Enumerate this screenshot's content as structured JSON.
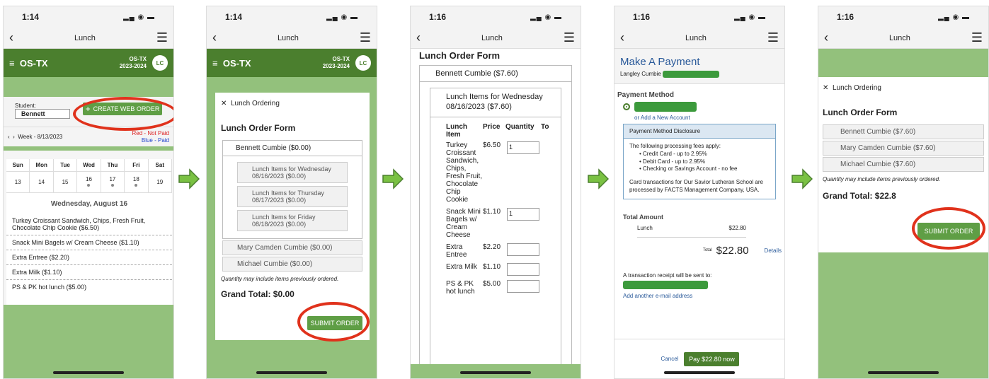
{
  "status_time": [
    "1:14",
    "1:14",
    "1:16",
    "1:16",
    "1:16"
  ],
  "nav_title": "Lunch",
  "appbar": {
    "org": "OS-TX",
    "org_short": "OS-TX",
    "year": "2023-2024",
    "avatar": "LC"
  },
  "screen1": {
    "student_label": "Student:",
    "student_value": "Bennett",
    "create_button": "CREATE WEB ORDER",
    "week_label": "Week - 8/13/2023",
    "legend_red": "Red - Not Paid",
    "legend_blue": "Blue - Paid",
    "days": [
      "Sun",
      "Mon",
      "Tue",
      "Wed",
      "Thu",
      "Fri",
      "Sat"
    ],
    "dates": [
      "13",
      "14",
      "15",
      "16",
      "17",
      "18",
      "19"
    ],
    "day_title": "Wednesday, August 16",
    "items": [
      "Turkey Croissant Sandwich, Chips, Fresh Fruit, Chocolate Chip Cookie ($6.50)",
      "Snack Mini Bagels w/ Cream Cheese ($1.10)",
      "Extra Entree ($2.20)",
      "Extra Milk ($1.10)",
      "PS & PK hot lunch ($5.00)"
    ]
  },
  "screen2": {
    "ordering": "Lunch Ordering",
    "form_title": "Lunch Order Form",
    "student_primary": "Bennett Cumbie ($0.00)",
    "day_items": [
      "Lunch Items for Wednesday 08/16/2023 ($0.00)",
      "Lunch Items for Thursday 08/17/2023 ($0.00)",
      "Lunch Items for Friday 08/18/2023 ($0.00)"
    ],
    "other_students": [
      "Mary Camden Cumbie ($0.00)",
      "Michael Cumbie ($0.00)"
    ],
    "note": "Quantity may include items previously ordered.",
    "grand_total": "Grand Total: $0.00",
    "submit": "SUBMIT ORDER"
  },
  "screen3": {
    "form_title": "Lunch Order Form",
    "student": "Bennett Cumbie ($7.60)",
    "day_header": "Lunch Items for Wednesday 08/16/2023 ($7.60)",
    "col_item": "Lunch Item",
    "col_price": "Price",
    "col_qty": "Quantity",
    "col_total": "To",
    "rows": [
      {
        "name": "Turkey Croissant Sandwich, Chips, Fresh Fruit, Chocolate Chip Cookie",
        "price": "$6.50",
        "qty": "1"
      },
      {
        "name": "Snack Mini Bagels w/ Cream Cheese",
        "price": "$1.10",
        "qty": "1"
      },
      {
        "name": "Extra Entree",
        "price": "$2.20",
        "qty": ""
      },
      {
        "name": "Extra Milk",
        "price": "$1.10",
        "qty": ""
      },
      {
        "name": "PS & PK hot lunch",
        "price": "$5.00",
        "qty": ""
      }
    ]
  },
  "screen4": {
    "title": "Make A Payment",
    "payer": "Langley Cumbie",
    "method_label": "Payment Method",
    "add_account": "or Add a New Account",
    "disclosure_title": "Payment Method Disclosure",
    "disclosure_intro": "The following processing fees apply:",
    "fees": [
      "Credit Card - up to 2.95%",
      "Debit Card - up to 2.95%",
      "Checking or Savings Account - no fee"
    ],
    "disclosure_body": "Card transactions for Our Savior Lutheran School are processed by FACTS Management Company, USA.",
    "total_amount_label": "Total Amount",
    "line_label": "Lunch",
    "line_amount": "$22.80",
    "total_label": "Total",
    "total_value": "$22.80",
    "details": "Details",
    "receipt_note": "A transaction receipt will be sent to:",
    "add_email": "Add another e-mail address",
    "cancel": "Cancel",
    "pay": "Pay $22.80 now"
  },
  "screen5": {
    "ordering": "Lunch Ordering",
    "form_title": "Lunch Order Form",
    "students": [
      "Bennett Cumbie ($7.60)",
      "Mary Camden Cumbie ($7.60)",
      "Michael Cumbie ($7.60)"
    ],
    "note": "Quantity may include items previously ordered.",
    "grand_total": "Grand Total: $22.8",
    "submit": "SUBMIT ORDER"
  },
  "colors": {
    "brand_green": "#4b7f2e",
    "bg_green": "#93c17c",
    "button_green": "#5f9e45",
    "annotation_red": "#e0321c",
    "arrow_green": "#7ac143"
  }
}
